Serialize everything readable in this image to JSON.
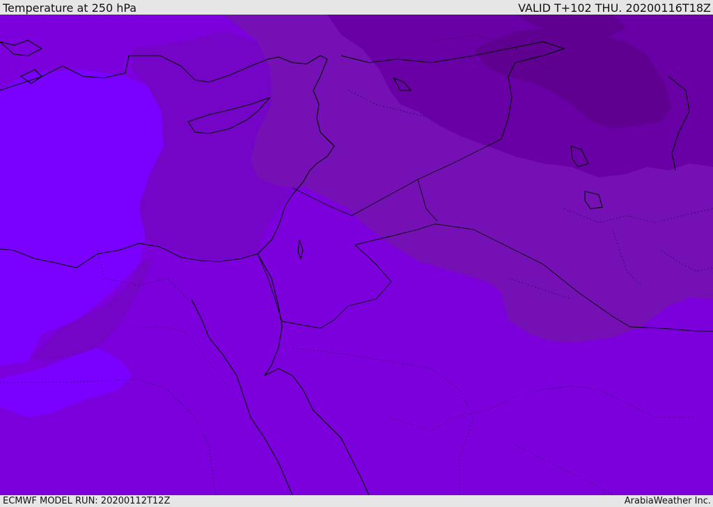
{
  "header": {
    "title": "Temperature at 250 hPa",
    "valid": "VALID T+102 THU. 20200116T18Z"
  },
  "footer": {
    "model_run": "ECMWF MODEL RUN: 20200112T12Z",
    "credit": "ArabiaWeather Inc."
  },
  "map": {
    "colors": {
      "bright_violet": "#7a00ff",
      "main_purple": "#7c00dc",
      "mid_purple": "#7505c6",
      "muted_purple": "#7410b4",
      "dark_purple": "#6800a6",
      "darkest_purple": "#5f0091",
      "coastline": "#000000"
    }
  }
}
